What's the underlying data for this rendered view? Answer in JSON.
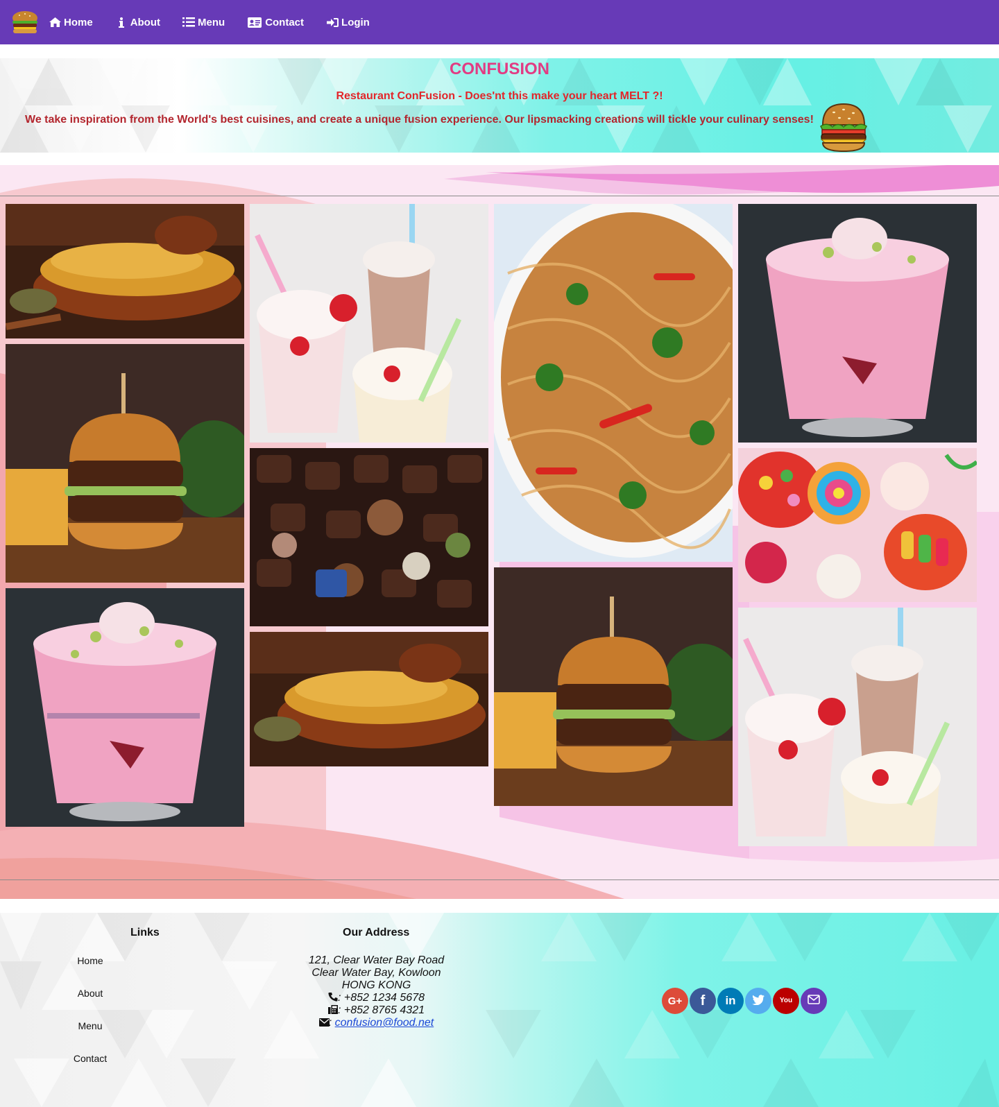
{
  "nav": {
    "brand_icon": "burger-logo-icon",
    "items": [
      {
        "label": "Home",
        "icon": "home-icon"
      },
      {
        "label": "About",
        "icon": "info-icon"
      },
      {
        "label": "Menu",
        "icon": "list-icon"
      },
      {
        "label": "Contact",
        "icon": "address-card-icon"
      },
      {
        "label": "Login",
        "icon": "sign-in-icon"
      }
    ],
    "bg_color": "#673ab7"
  },
  "header": {
    "title": "CONFUSION",
    "subtitle": "Restaurant ConFusion - Does'nt this make your heart MELT ?!",
    "description": "We take inspiration from the World's best cuisines, and create a unique fusion experience. Our lipsmacking creations will tickle your culinary senses!",
    "title_color": "#e23b83",
    "text_color": "#b3262e"
  },
  "gallery": {
    "images": [
      {
        "col": 1,
        "subject": "biryani"
      },
      {
        "col": 1,
        "subject": "burger"
      },
      {
        "col": 1,
        "subject": "falooda"
      },
      {
        "col": 2,
        "subject": "milkshakes"
      },
      {
        "col": 2,
        "subject": "chocolates"
      },
      {
        "col": 2,
        "subject": "biryani"
      },
      {
        "col": 3,
        "subject": "noodles"
      },
      {
        "col": 3,
        "subject": "burger"
      },
      {
        "col": 4,
        "subject": "falooda"
      },
      {
        "col": 4,
        "subject": "candy"
      },
      {
        "col": 4,
        "subject": "milkshakes"
      }
    ]
  },
  "footer": {
    "links_title": "Links",
    "links": [
      "Home",
      "About",
      "Menu",
      "Contact"
    ],
    "address_title": "Our Address",
    "address_lines": [
      "121, Clear Water Bay Road",
      "Clear Water Bay, Kowloon",
      "HONG KONG"
    ],
    "phone": ": +852 1234 5678",
    "fax": ": +852 8765 4321",
    "email_sep": ": ",
    "email": "confusion@food.net",
    "socials": [
      {
        "name": "google-plus",
        "text": "G+",
        "color": "#dd4b39"
      },
      {
        "name": "facebook",
        "text": "f",
        "color": "#3b5998"
      },
      {
        "name": "linkedin",
        "text": "in",
        "color": "#007bb6"
      },
      {
        "name": "twitter",
        "text": "t",
        "color": "#55acee"
      },
      {
        "name": "youtube",
        "text": "You",
        "color": "#bb0000"
      },
      {
        "name": "mail",
        "text": "✉",
        "color": "#673ab7"
      }
    ]
  }
}
